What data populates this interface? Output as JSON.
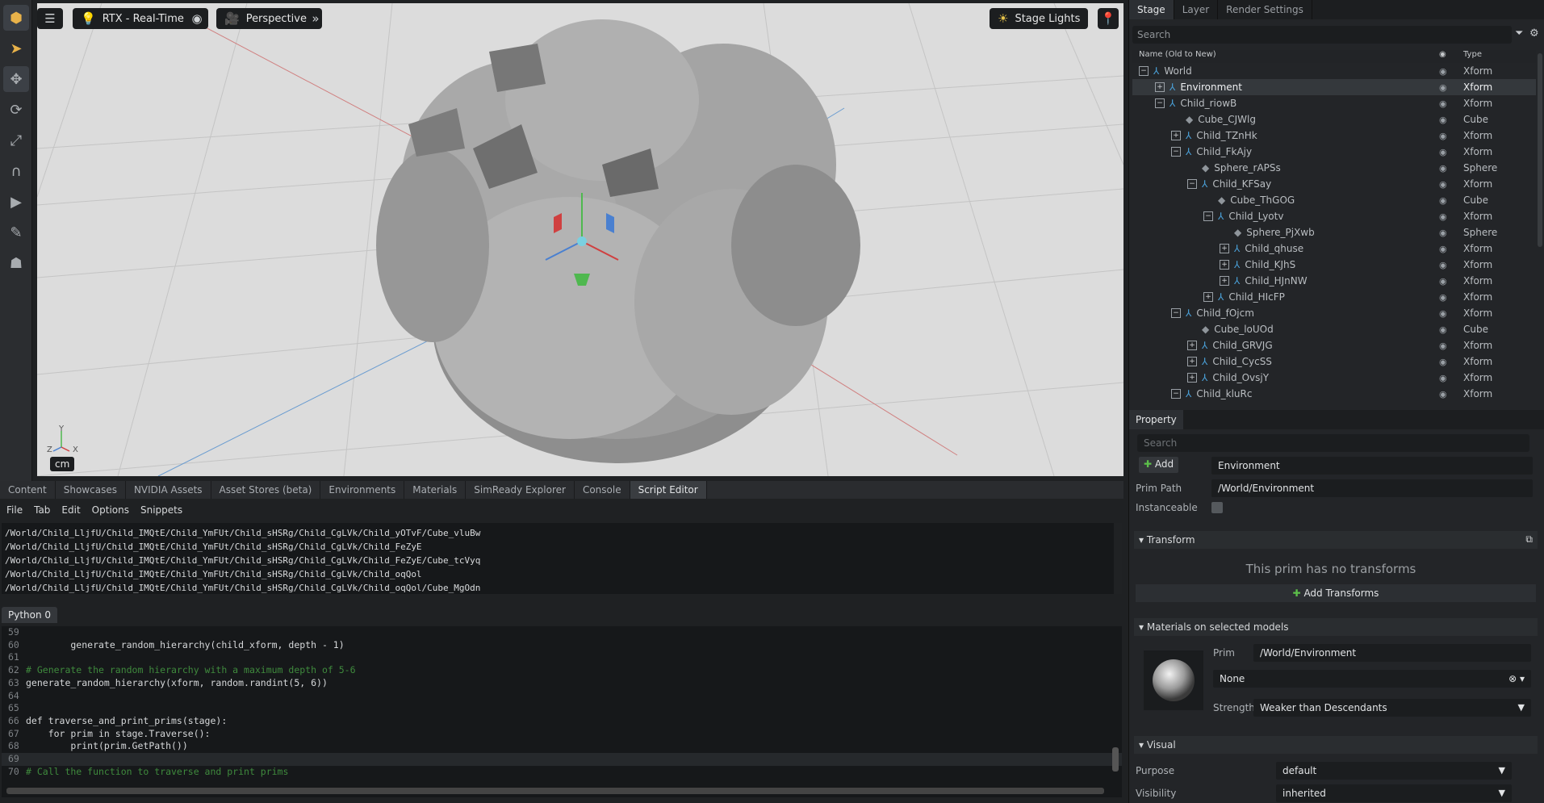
{
  "toolbar_left": {
    "tools": [
      "select-mode-icon",
      "pointer-icon",
      "move-icon",
      "rotate-icon",
      "scale-icon",
      "snap-icon",
      "play-icon",
      "paint-icon",
      "physics-icon"
    ]
  },
  "viewport": {
    "settings_icon": "settings-icon",
    "renderer_label": "RTX - Real-Time",
    "camera_label": "Perspective",
    "lights_label": "Stage Lights",
    "unit_label": "cm",
    "axis_labels": {
      "y": "Y",
      "z": "Z",
      "x": "X"
    }
  },
  "bottom_tabs": [
    "Content",
    "Showcases",
    "NVIDIA Assets",
    "Asset Stores (beta)",
    "Environments",
    "Materials",
    "SimReady Explorer",
    "Console",
    "Script Editor"
  ],
  "script_editor": {
    "menu": [
      "File",
      "Tab",
      "Edit",
      "Options",
      "Snippets"
    ],
    "output_lines": [
      "/World/Child_LljfU/Child_IMQtE/Child_YmFUt/Child_sHSRg/Child_CgLVk/Child_yOTvF/Cube_vluBw",
      "/World/Child_LljfU/Child_IMQtE/Child_YmFUt/Child_sHSRg/Child_CgLVk/Child_FeZyE",
      "/World/Child_LljfU/Child_IMQtE/Child_YmFUt/Child_sHSRg/Child_CgLVk/Child_FeZyE/Cube_tcVyq",
      "/World/Child_LljfU/Child_IMQtE/Child_YmFUt/Child_sHSRg/Child_CgLVk/Child_oqQol",
      "/World/Child_LljfU/Child_IMQtE/Child_YmFUt/Child_sHSRg/Child_CgLVk/Child_oqQol/Cube_MgOdn"
    ],
    "python_tab": "Python 0",
    "code_lines": [
      {
        "n": "59",
        "text": "",
        "comment": false
      },
      {
        "n": "60",
        "text": "        generate_random_hierarchy(child_xform, depth - 1)",
        "comment": false
      },
      {
        "n": "61",
        "text": "",
        "comment": false
      },
      {
        "n": "62",
        "text": "# Generate the random hierarchy with a maximum depth of 5-6",
        "comment": true
      },
      {
        "n": "63",
        "text": "generate_random_hierarchy(xform, random.randint(5, 6))",
        "comment": false
      },
      {
        "n": "64",
        "text": "",
        "comment": false
      },
      {
        "n": "65",
        "text": "",
        "comment": false
      },
      {
        "n": "66",
        "text": "def traverse_and_print_prims(stage):",
        "comment": false
      },
      {
        "n": "67",
        "text": "    for prim in stage.Traverse():",
        "comment": false
      },
      {
        "n": "68",
        "text": "        print(prim.GetPath())",
        "comment": false
      },
      {
        "n": "69",
        "text": "",
        "comment": false
      },
      {
        "n": "70",
        "text": "# Call the function to traverse and print prims",
        "comment": true
      }
    ]
  },
  "stage": {
    "tabs": [
      "Stage",
      "Layer",
      "Render Settings"
    ],
    "search_placeholder": "Search",
    "col_name": "Name (Old to New)",
    "col_type": "Type",
    "rows": [
      {
        "name": "World",
        "type": "Xform",
        "exp": "−",
        "kind": "xform",
        "level": 0,
        "selected": false
      },
      {
        "name": "Environment",
        "type": "Xform",
        "exp": "+",
        "kind": "xform",
        "level": 1,
        "selected": true
      },
      {
        "name": "Child_riowB",
        "type": "Xform",
        "exp": "−",
        "kind": "xform",
        "level": 1,
        "selected": false
      },
      {
        "name": "Cube_CJWlg",
        "type": "Cube",
        "exp": "",
        "kind": "mesh",
        "level": 2,
        "selected": false
      },
      {
        "name": "Child_TZnHk",
        "type": "Xform",
        "exp": "+",
        "kind": "xform",
        "level": 2,
        "selected": false
      },
      {
        "name": "Child_FkAjy",
        "type": "Xform",
        "exp": "−",
        "kind": "xform",
        "level": 2,
        "selected": false
      },
      {
        "name": "Sphere_rAPSs",
        "type": "Sphere",
        "exp": "",
        "kind": "mesh",
        "level": 3,
        "selected": false
      },
      {
        "name": "Child_KFSay",
        "type": "Xform",
        "exp": "−",
        "kind": "xform",
        "level": 3,
        "selected": false
      },
      {
        "name": "Cube_ThGOG",
        "type": "Cube",
        "exp": "",
        "kind": "mesh",
        "level": 4,
        "selected": false
      },
      {
        "name": "Child_Lyotv",
        "type": "Xform",
        "exp": "−",
        "kind": "xform",
        "level": 4,
        "selected": false
      },
      {
        "name": "Sphere_PjXwb",
        "type": "Sphere",
        "exp": "",
        "kind": "mesh",
        "level": 5,
        "selected": false
      },
      {
        "name": "Child_qhuse",
        "type": "Xform",
        "exp": "+",
        "kind": "xform",
        "level": 5,
        "selected": false
      },
      {
        "name": "Child_KJhS",
        "type": "Xform",
        "exp": "+",
        "kind": "xform",
        "level": 5,
        "selected": false
      },
      {
        "name": "Child_HJnNW",
        "type": "Xform",
        "exp": "+",
        "kind": "xform",
        "level": 5,
        "selected": false
      },
      {
        "name": "Child_HIcFP",
        "type": "Xform",
        "exp": "+",
        "kind": "xform",
        "level": 4,
        "selected": false
      },
      {
        "name": "Child_fOjcm",
        "type": "Xform",
        "exp": "−",
        "kind": "xform",
        "level": 2,
        "selected": false
      },
      {
        "name": "Cube_loUOd",
        "type": "Cube",
        "exp": "",
        "kind": "mesh",
        "level": 3,
        "selected": false
      },
      {
        "name": "Child_GRVJG",
        "type": "Xform",
        "exp": "+",
        "kind": "xform",
        "level": 3,
        "selected": false
      },
      {
        "name": "Child_CycSS",
        "type": "Xform",
        "exp": "+",
        "kind": "xform",
        "level": 3,
        "selected": false
      },
      {
        "name": "Child_OvsjY",
        "type": "Xform",
        "exp": "+",
        "kind": "xform",
        "level": 3,
        "selected": false
      },
      {
        "name": "Child_kluRc",
        "type": "Xform",
        "exp": "−",
        "kind": "xform",
        "level": 2,
        "selected": false
      }
    ]
  },
  "property": {
    "tab": "Property",
    "search_placeholder": "Search",
    "add_label": "Add",
    "prim_name": "Environment",
    "prim_path_label": "Prim Path",
    "prim_path": "/World/Environment",
    "instanceable_label": "Instanceable",
    "transform_section": "Transform",
    "no_transforms": "This prim has no transforms",
    "add_transforms": "Add Transforms",
    "materials_section": "Materials on selected models",
    "prim_label": "Prim",
    "material_prim": "/World/Environment",
    "material_value": "None",
    "strength_label": "Strength",
    "strength_value": "Weaker than Descendants",
    "visual_section": "Visual",
    "purpose_label": "Purpose",
    "purpose_value": "default",
    "visibility_label": "Visibility",
    "visibility_value": "inherited"
  }
}
